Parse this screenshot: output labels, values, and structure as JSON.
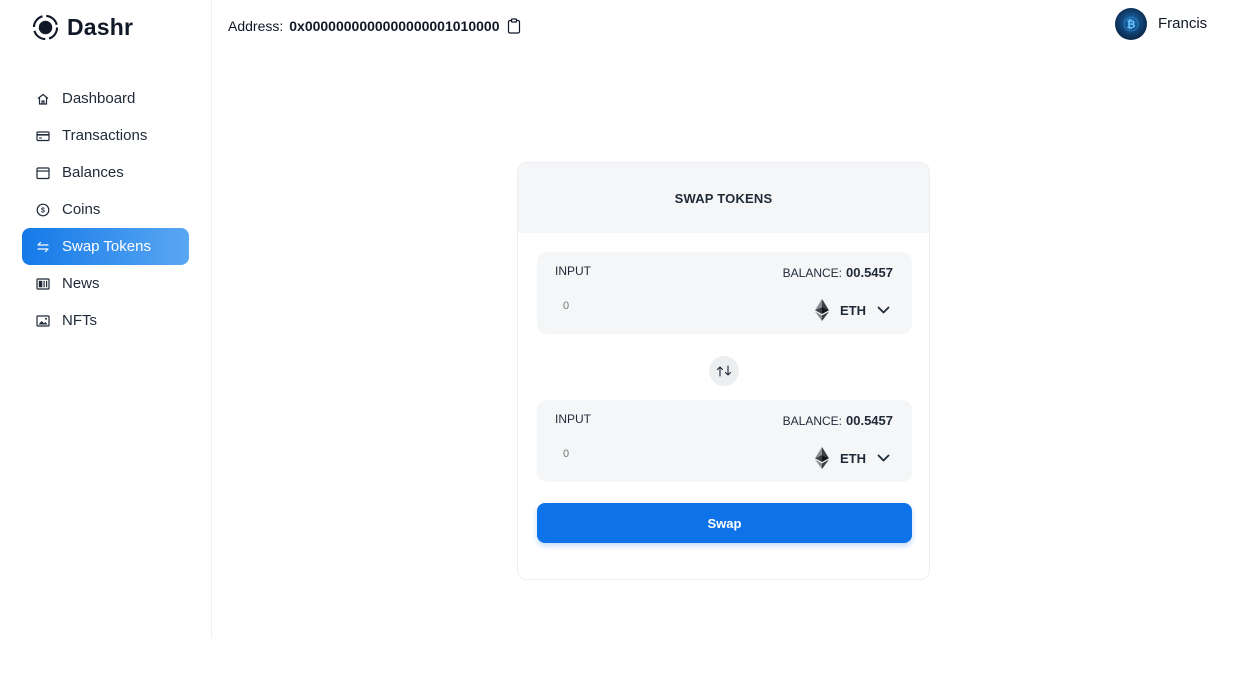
{
  "app": {
    "name": "Dashr"
  },
  "header": {
    "address_label": "Address:",
    "address_value": "0x0000000000000000001010000",
    "user_name": "Francis"
  },
  "sidebar": {
    "items": [
      {
        "label": "Dashboard",
        "icon": "home-icon",
        "active": false
      },
      {
        "label": "Transactions",
        "icon": "credit-card-icon",
        "active": false
      },
      {
        "label": "Balances",
        "icon": "wallet-icon",
        "active": false
      },
      {
        "label": "Coins",
        "icon": "coin-icon",
        "active": false
      },
      {
        "label": "Swap Tokens",
        "icon": "swap-arrows-icon",
        "active": true
      },
      {
        "label": "News",
        "icon": "newspaper-icon",
        "active": false
      },
      {
        "label": "NFTs",
        "icon": "image-icon",
        "active": false
      }
    ]
  },
  "swap": {
    "title": "SWAP TOKENS",
    "from": {
      "label": "INPUT",
      "balance_label": "BALANCE:",
      "balance_value": "00.5457",
      "amount_placeholder": "0",
      "token": "ETH"
    },
    "to": {
      "label": "INPUT",
      "balance_label": "BALANCE:",
      "balance_value": "00.5457",
      "amount_placeholder": "0",
      "token": "ETH"
    },
    "button_label": "Swap"
  },
  "colors": {
    "primary": "#0e73e8",
    "active_gradient_start": "#1479e8",
    "active_gradient_end": "#5aa7f2",
    "panel_bg": "#f4f6f7"
  }
}
